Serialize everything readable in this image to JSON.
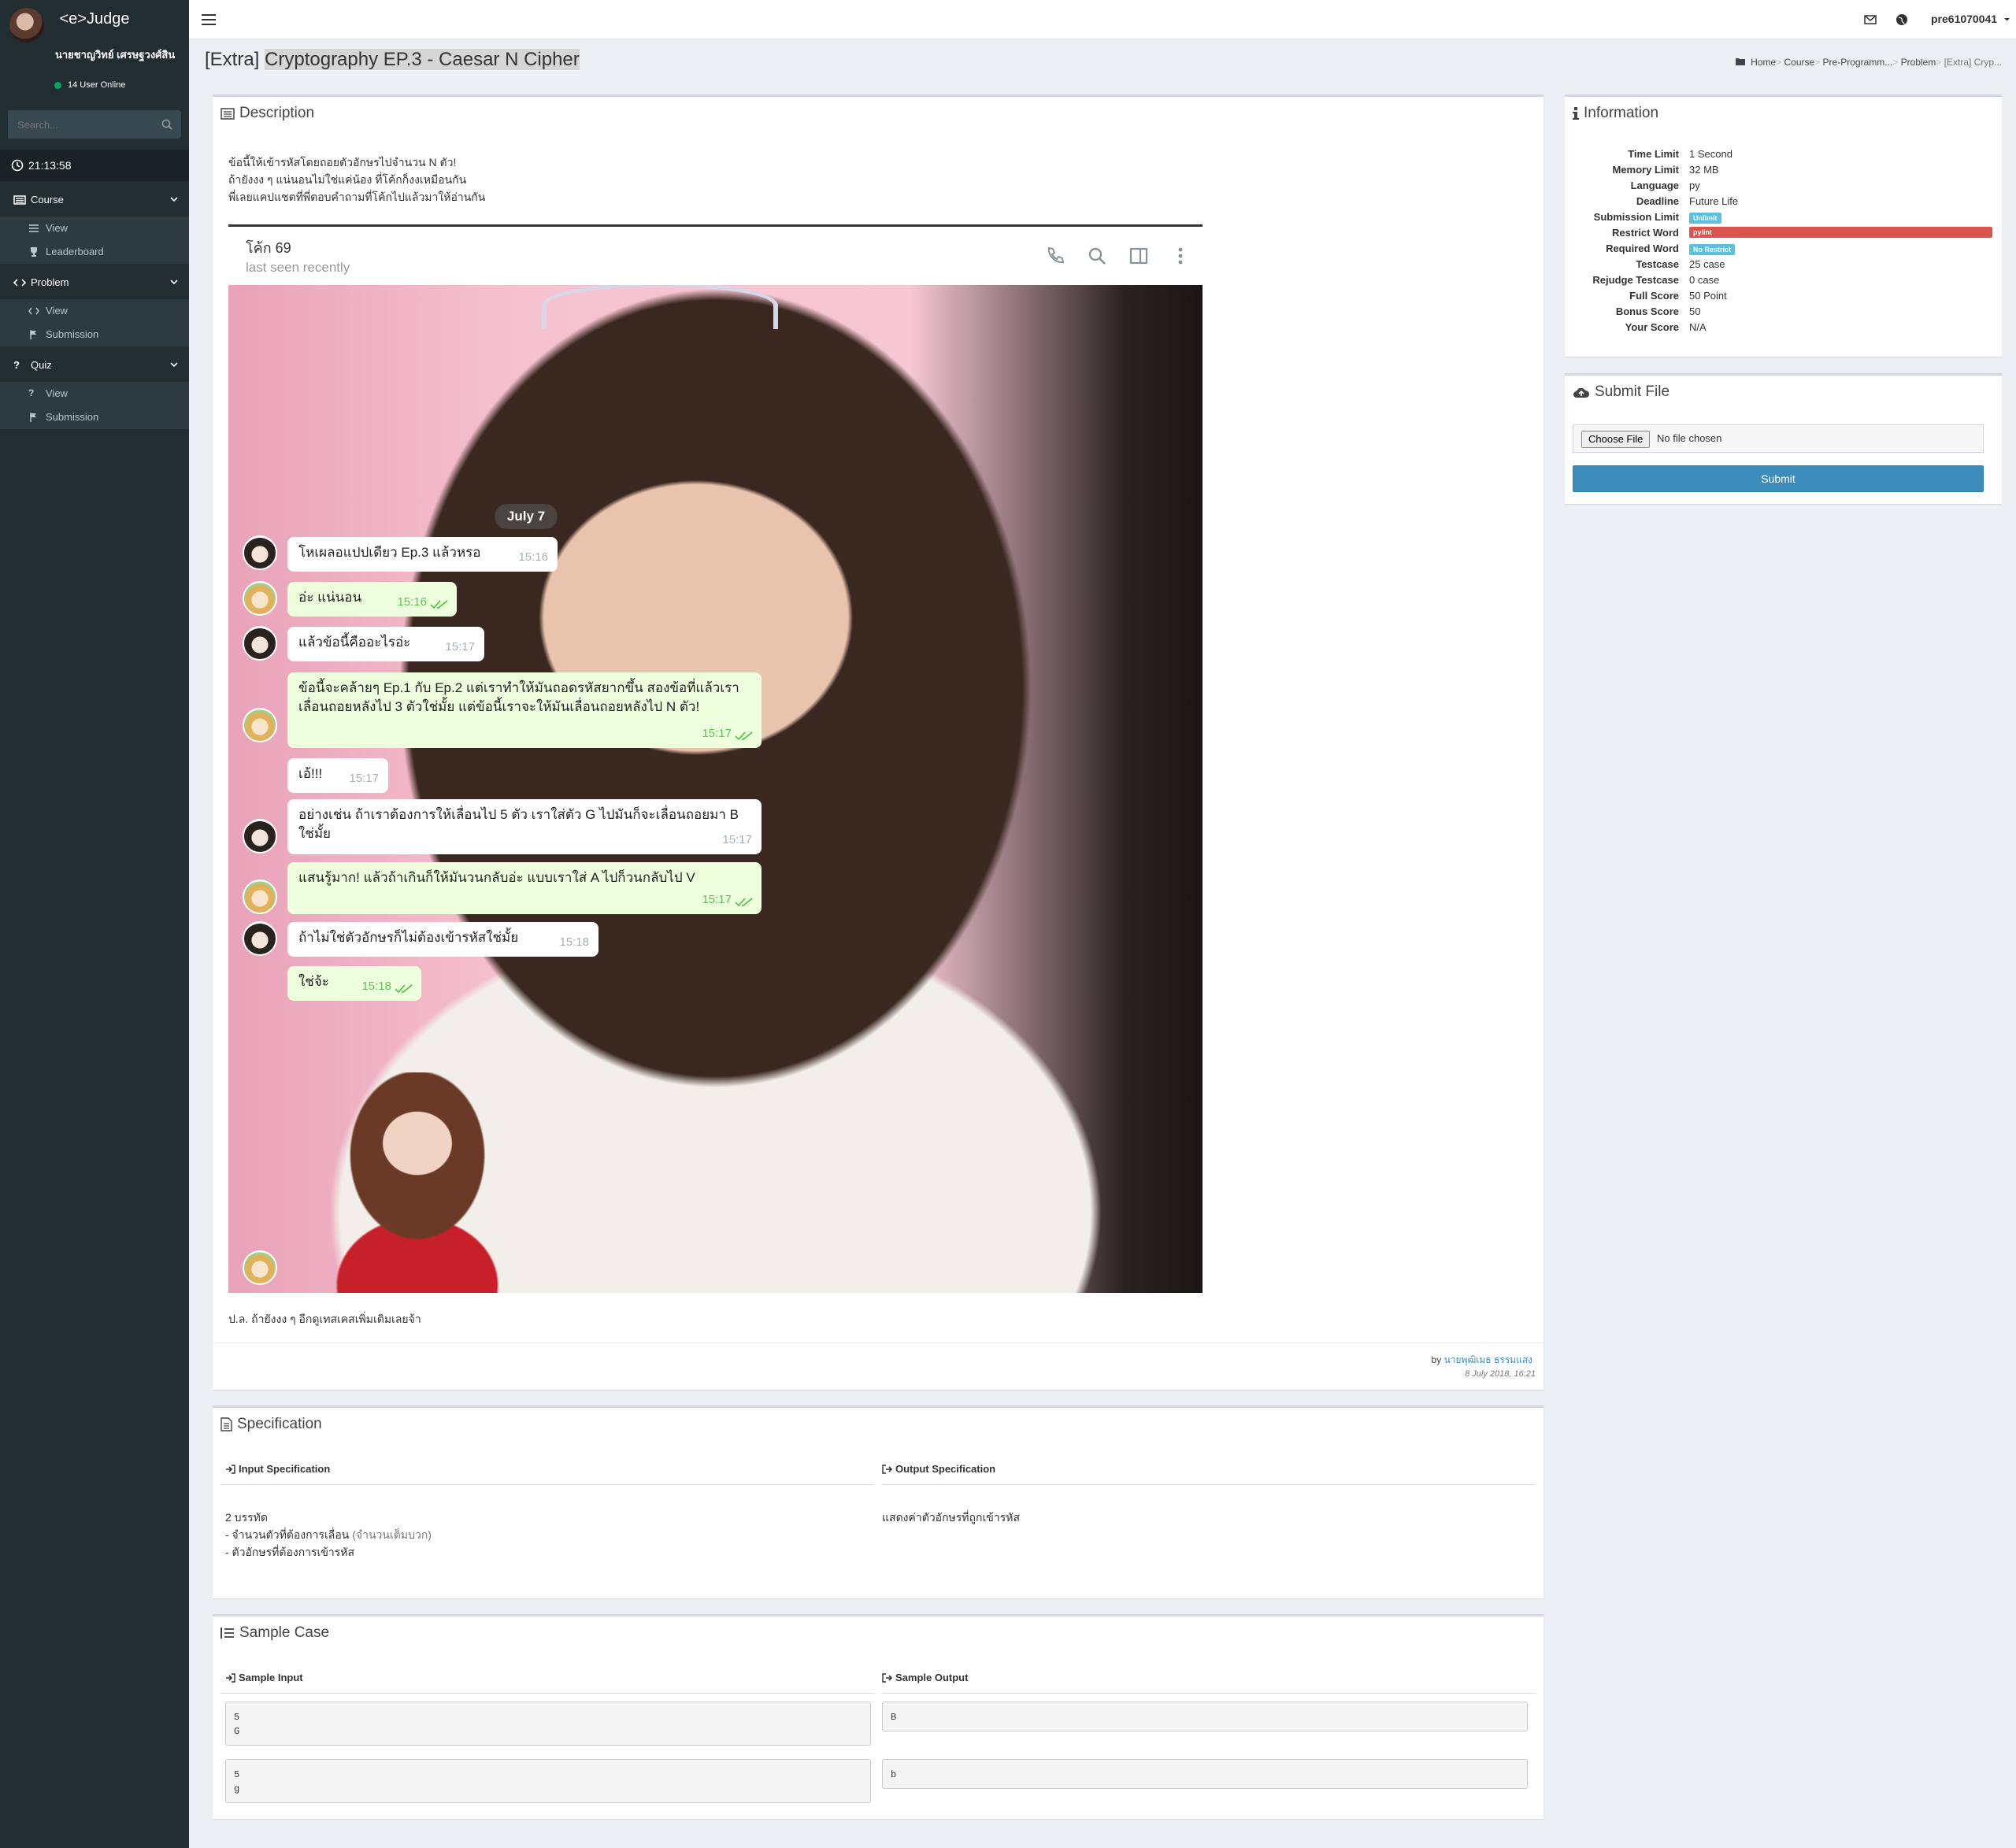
{
  "app": {
    "logo": "<e>Judge"
  },
  "sidebar": {
    "user_name": "นายชาญวิทย์ เศรษฐวงศ์สิน",
    "online_text": "14 User Online",
    "search_placeholder": "Search...",
    "clock": "21:13:58",
    "sections": [
      {
        "label": "Course",
        "items": [
          {
            "label": "View"
          },
          {
            "label": "Leaderboard"
          }
        ]
      },
      {
        "label": "Problem",
        "items": [
          {
            "label": "View"
          },
          {
            "label": "Submission"
          }
        ]
      },
      {
        "label": "Quiz",
        "items": [
          {
            "label": "View"
          },
          {
            "label": "Submission"
          }
        ]
      }
    ]
  },
  "topbar": {
    "user": "pre61070041"
  },
  "page": {
    "title_prefix": "[Extra]",
    "title_main": "Cryptography EP.3 - Caesar N Cipher",
    "breadcrumb": [
      "Home",
      "Course",
      "Pre-Programm...",
      "Problem",
      "[Extra] Cryp..."
    ]
  },
  "description": {
    "title": "Description",
    "lines": [
      "ข้อนี้ให้เข้ารหัสโดยถอยตัวอักษรไปจำนวน N ตัว!",
      "ถ้ายังงง ๆ แน่นอนไม่ใช่แค่น้อง ที่โค้กก็งงเหมือนกัน",
      "พี่เลยแคปแชตที่พี่ตอบคำถามที่โค้กไปแล้วมาให้อ่านกัน"
    ],
    "chat": {
      "name": "โค้ก 69",
      "status": "last seen recently",
      "date": "July 7",
      "messages": [
        {
          "text": "โหเผลอแปปเดียว Ep.3 แล้วหรอ",
          "time": "15:16"
        },
        {
          "text": "อ่ะ แน่นอน",
          "time": "15:16"
        },
        {
          "text": "แล้วข้อนี้คืออะไรอ่ะ",
          "time": "15:17"
        },
        {
          "text": "ข้อนี้จะคล้ายๆ Ep.1 กับ Ep.2 แต่เราทำให้มันถอดรหัสยากขึ้น สองข้อที่แล้วเราเลื่อนถอยหลังไป 3 ตัวใช่มั้ย แต่ข้อนี้เราจะให้มันเลื่อนถอยหลังไป N ตัว!",
          "time": "15:17"
        },
        {
          "text": "เอ้!!!",
          "time": "15:17"
        },
        {
          "text": "อย่างเช่น ถ้าเราต้องการให้เลื่อนไป 5 ตัว เราใส่ตัว G ไปมันก็จะเลื่อนถอยมา B ใช่มั้ย",
          "time": "15:17"
        },
        {
          "text": "แสนรู้มาก! แล้วถ้าเกินก็ให้มันวนกลับอ่ะ แบบเราใส่ A ไปก็วนกลับไป V",
          "time": "15:17"
        },
        {
          "text": "ถ้าไม่ใช่ตัวอักษรก็ไม่ต้องเข้ารหัสใช่มั้ย",
          "time": "15:18"
        },
        {
          "text": "ใช่จ้ะ",
          "time": "15:18"
        }
      ]
    },
    "footer_note": "ป.ล. ถ้ายังงง ๆ อีกดูเทสเคสเพิ่มเติมเลยจ้า",
    "author_prefix": "by",
    "author": "นายพุฒิเมธ ธรรมแสง",
    "posted": "8 July 2018, 16:21"
  },
  "information": {
    "title": "Information",
    "rows": [
      {
        "label": "Time Limit",
        "value": "1 Second"
      },
      {
        "label": "Memory Limit",
        "value": "32 MB"
      },
      {
        "label": "Language",
        "value": "py"
      },
      {
        "label": "Deadline",
        "value": "Future Life"
      },
      {
        "label": "Submission Limit",
        "value": "Unlimit"
      },
      {
        "label": "Restrict Word",
        "value": "pylint"
      },
      {
        "label": "Required Word",
        "value": "No Restrict"
      },
      {
        "label": "Testcase",
        "value": "25 case"
      },
      {
        "label": "Rejudge Testcase",
        "value": "0 case"
      },
      {
        "label": "Full Score",
        "value": "50 Point"
      },
      {
        "label": "Bonus Score",
        "value": "50"
      },
      {
        "label": "Your Score",
        "value": "N/A"
      }
    ],
    "colors": {
      "unlimit": "#5bc0de",
      "pylint": "#d9534f",
      "no_restrict": "#5bc0de"
    }
  },
  "submit": {
    "title": "Submit File",
    "choose_label": "Choose File",
    "file_status": "No file chosen",
    "submit_label": "Submit"
  },
  "specification": {
    "title": "Specification",
    "input_title": "Input Specification",
    "output_title": "Output Specification",
    "input_line1": "2 บรรทัด",
    "input_line2a": "- จำนวนตัวที่ต้องการเลื่อน",
    "input_line2b": "(จำนวนเต็มบวก)",
    "input_line3": "- ตัวอักษรที่ต้องการเข้ารหัส",
    "output_text": "แสดงค่าตัวอักษรที่ถูกเข้ารหัส"
  },
  "samples": {
    "title": "Sample Case",
    "input_title": "Sample Input",
    "output_title": "Sample Output",
    "cases": [
      {
        "input": "5\nG",
        "output": "B"
      },
      {
        "input": "5\ng",
        "output": "b"
      }
    ]
  }
}
